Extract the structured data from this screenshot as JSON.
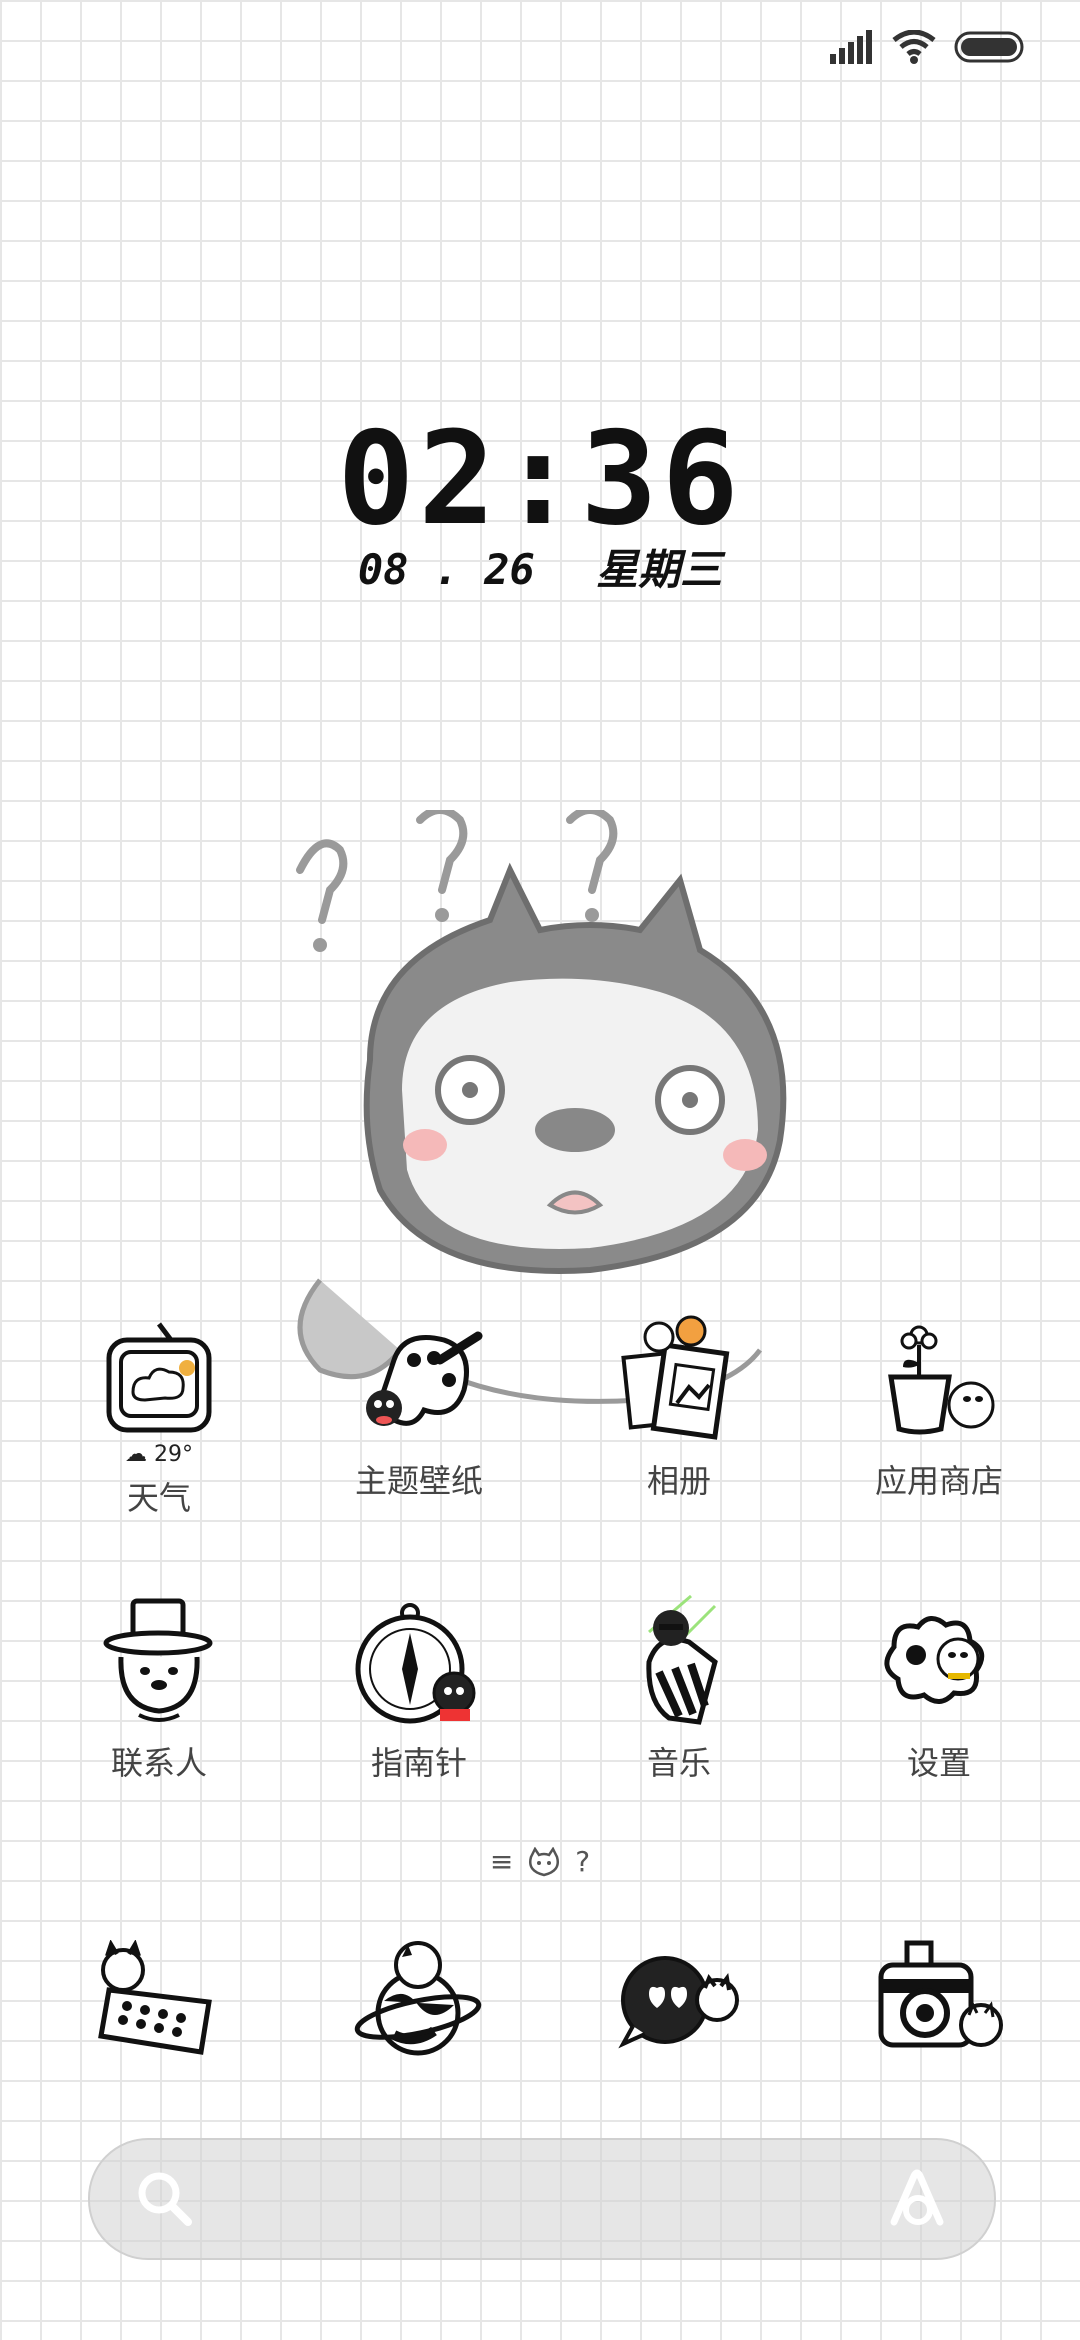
{
  "status_bar": {
    "signal_icon": "signal-bars-icon",
    "wifi_icon": "wifi-icon",
    "battery_icon": "battery-icon"
  },
  "lockscreen": {
    "time": "02:36",
    "date": "08 . 26",
    "weekday": "星期三"
  },
  "apps_row1": [
    {
      "label": "天气",
      "icon": "weather-tv-icon",
      "extra": "☁ 29°"
    },
    {
      "label": "主题壁纸",
      "icon": "palette-icon"
    },
    {
      "label": "相册",
      "icon": "gallery-photos-icon"
    },
    {
      "label": "应用商店",
      "icon": "flower-pot-icon"
    }
  ],
  "apps_row2": [
    {
      "label": "联系人",
      "icon": "top-hat-dog-icon"
    },
    {
      "label": "指南针",
      "icon": "compass-icon"
    },
    {
      "label": "音乐",
      "icon": "music-icon"
    },
    {
      "label": "设置",
      "icon": "gear-icon"
    }
  ],
  "page_indicator": {
    "menu_icon": "≡",
    "current_icon": "dog-face-icon",
    "help": "?"
  },
  "dock": [
    {
      "icon": "phone-keypad-icon"
    },
    {
      "icon": "planet-icon"
    },
    {
      "icon": "chat-bubble-icon"
    },
    {
      "icon": "camera-icon"
    }
  ],
  "search": {
    "search_icon": "search-icon",
    "assistant_icon": "assistant-icon"
  }
}
